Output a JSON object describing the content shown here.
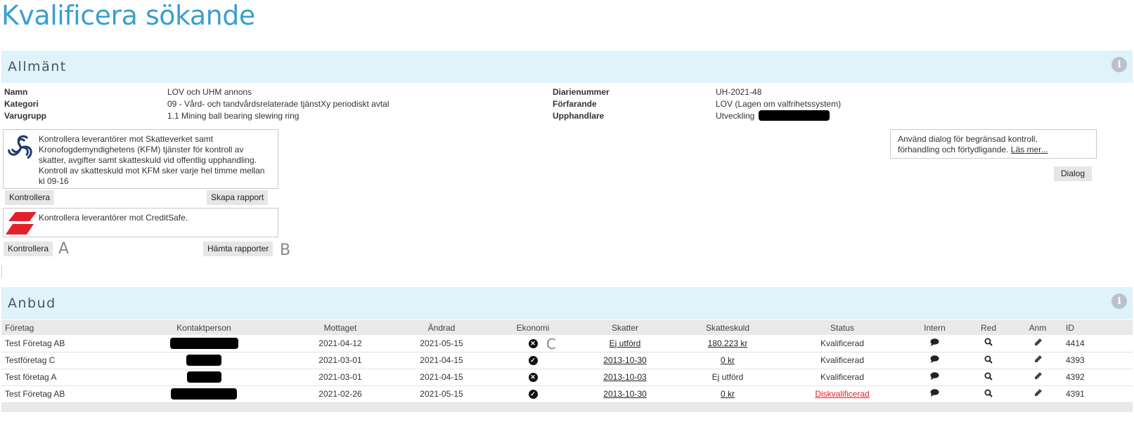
{
  "page_title": "Kvalificera sökande",
  "general": {
    "section_title": "Allmänt",
    "info_icon": "i",
    "fields_left": [
      {
        "label": "Namn",
        "value": "LOV och UHM annons"
      },
      {
        "label": "Kategori",
        "value": "09 - Vård- och tandvårdsrelaterade tjänstXy periodiskt avtal"
      },
      {
        "label": "Varugrupp",
        "value": "1.1 Mining ball bearing slewing ring"
      }
    ],
    "fields_right": [
      {
        "label": "Diarienummer",
        "value": "UH-2021-48"
      },
      {
        "label": "Förfarande",
        "value": "LOV (Lagen om valfrihetssystem)"
      },
      {
        "label": "Upphandlare",
        "value": "Utveckling"
      }
    ]
  },
  "kfm_box": {
    "logo_icon": "skatteverket-logo",
    "lines": [
      "Kontrollera leverantörer mot Skatteverket samt",
      "Kronofogdemyndighetens (KFM) tjänster för kontroll av",
      "skatter, avgifter samt skatteskuld vid offentlig upphandling.",
      "Kontroll av skatteskuld mot KFM sker varje hel timme mellan",
      "kl 09-16"
    ],
    "check_button": "Kontrollera",
    "report_button": "Skapa rapport"
  },
  "creditsafe_box": {
    "logo_icon": "creditsafe-logo",
    "text": "Kontrollera leverantörer mot CreditSafe.",
    "check_button": "Kontrollera",
    "report_button": "Hämta rapporter",
    "marker_a": "A",
    "marker_b": "B"
  },
  "dialog": {
    "line1": "Använd dialog för begränsad kontroll,",
    "line2": "förhandling och förtydligande.",
    "link": "Läs mer...",
    "button": "Dialog"
  },
  "bids": {
    "section_title": "Anbud",
    "info_icon": "i",
    "marker_c": "C",
    "columns": [
      "Företag",
      "Kontaktperson",
      "Mottaget",
      "Ändrad",
      "Ekonomi",
      "Skatter",
      "Skatteskuld",
      "Status",
      "Intern",
      "Red",
      "Anm",
      "ID"
    ],
    "rows": [
      {
        "company": "Test Företag AB",
        "received": "2021-04-12",
        "changed": "2021-05-15",
        "economy": "x-icon",
        "taxes": "Ej utförd",
        "tax_debt": "180.223 kr",
        "status": "Kvalificerad",
        "id": "4414"
      },
      {
        "company": "Testföretag C",
        "received": "2021-03-01",
        "changed": "2021-04-15",
        "economy": "check-icon",
        "taxes": "2013-10-30",
        "tax_debt": "0 kr",
        "status": "Kvalificerad",
        "id": "4393"
      },
      {
        "company": "Test företag A",
        "received": "2021-03-01",
        "changed": "2021-04-15",
        "economy": "x-icon",
        "taxes": "2013-10-03",
        "tax_debt": "Ej utförd",
        "status": "Kvalificerad",
        "id": "4392"
      },
      {
        "company": "Test Företag AB",
        "received": "2021-02-26",
        "changed": "2021-05-15",
        "economy": "check-icon",
        "taxes": "2013-10-30",
        "tax_debt": "0 kr",
        "status": "Diskvalificerad",
        "id": "4391"
      }
    ]
  },
  "colors": {
    "title": "#3a9fd0",
    "header_bg": "#dff3fb",
    "disqualified": "#e02020"
  }
}
